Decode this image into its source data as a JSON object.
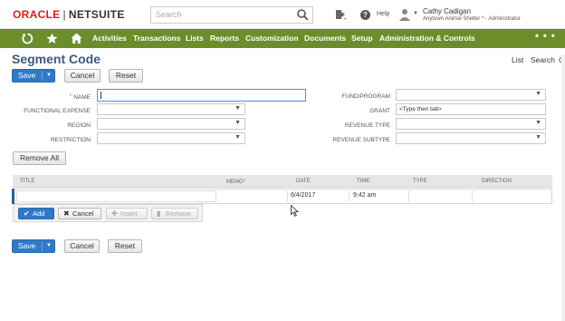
{
  "header": {
    "logo_oracle": "ORACLE",
    "logo_separator": "|",
    "logo_netsuite": "NETSUITE",
    "search_placeholder": "Search",
    "help_label": "Help",
    "user_name": "Cathy Cadigan",
    "user_role": "Anytown Animal Shelter * - Administrator",
    "icons": [
      "search-icon",
      "recent-records-icon",
      "help-icon",
      "avatar-icon"
    ]
  },
  "nav": {
    "icons": [
      "recent-icon",
      "star-icon",
      "home-icon"
    ],
    "items": [
      "Activities",
      "Transactions",
      "Lists",
      "Reports",
      "Customization",
      "Documents",
      "Setup",
      "Administration & Controls"
    ],
    "more": "• • •"
  },
  "page": {
    "title": "Segment Code",
    "links": [
      "List",
      "Search"
    ],
    "edge_letter": "C"
  },
  "buttons": {
    "save": "Save",
    "cancel": "Cancel",
    "reset": "Reset",
    "remove_all": "Remove All"
  },
  "form": {
    "left": [
      {
        "label": "NAME",
        "required": true,
        "value": "",
        "type": "text"
      },
      {
        "label": "FUNCTIONAL EXPENSE",
        "value": "",
        "type": "select"
      },
      {
        "label": "REGION",
        "value": "",
        "type": "select"
      },
      {
        "label": "RESTRICTION",
        "value": "",
        "type": "select"
      }
    ],
    "right": [
      {
        "label": "FUND/PROGRAM",
        "value": "",
        "type": "select"
      },
      {
        "label": "GRANT",
        "value": "<Type then tab>",
        "type": "text"
      },
      {
        "label": "REVENUE TYPE",
        "value": "",
        "type": "select"
      },
      {
        "label": "REVENUE SUBTYPE",
        "value": "",
        "type": "select"
      }
    ],
    "required_marker": "*"
  },
  "sublist": {
    "columns": [
      "TITLE",
      "MEMO",
      "DATE",
      "TIME",
      "TYPE",
      "DIRECTION"
    ],
    "memo_required_marker": "*",
    "row": {
      "title": "",
      "memo": "",
      "date": "6/4/2017",
      "time": "9:42 am",
      "type": "",
      "direction": ""
    },
    "actions": {
      "add": "Add",
      "cancel": "Cancel",
      "insert": "Insert",
      "remove": "Remove"
    }
  },
  "colors": {
    "nav_green": "#6b8e2a",
    "title_blue": "#3c5a7a",
    "primary_blue": "#2f79c8",
    "oracle_red": "#e01b22"
  }
}
